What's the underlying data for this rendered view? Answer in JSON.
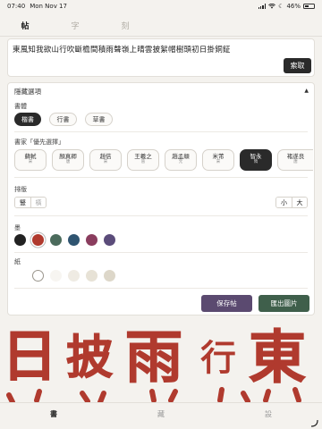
{
  "status": {
    "time": "07:40",
    "date": "Mon Nov 17",
    "battery": "46%",
    "battery_level": 0.46
  },
  "tabs": [
    {
      "label": "帖",
      "active": true
    },
    {
      "label": "字",
      "active": false
    },
    {
      "label": "刻",
      "active": false
    }
  ],
  "input": {
    "text": "東風知我欲山行吹斷檐間積雨聲嶺上晴雲披絮帽樹頭初日掛銅鉦"
  },
  "search_button": "索取",
  "options": {
    "header": "隱藏選項",
    "toggle_icon": "triangle-up-icon",
    "style_label": "書體",
    "styles": [
      "楷書",
      "行書",
      "草書"
    ],
    "style_selected": "楷書",
    "calligrapher_label": "書家「優先選擇」",
    "calligraphers": [
      {
        "name": "蘇軾",
        "era": "宋"
      },
      {
        "name": "顏真卿",
        "era": "唐"
      },
      {
        "name": "趙佶",
        "era": "宋"
      },
      {
        "name": "王羲之",
        "era": "晉"
      },
      {
        "name": "趙孟頫",
        "era": "元"
      },
      {
        "name": "米芾",
        "era": "宋"
      },
      {
        "name": "智永",
        "era": "隋",
        "selected": true
      },
      {
        "name": "褚遂良",
        "era": "唐"
      }
    ],
    "layout_label": "排版",
    "orientation": [
      "豎",
      "橫"
    ],
    "orientation_selected": "豎",
    "size": [
      "小",
      "大"
    ],
    "ink_label": "墨",
    "ink_colors": [
      "#222222",
      "#b03a2e",
      "#4b6b5c",
      "#2f5470",
      "#8a3d5e",
      "#5b4c7a"
    ],
    "ink_selected": 1,
    "paper_label": "紙",
    "paper_colors": [
      "#ffffff",
      "#f7f5f1",
      "#efebe3",
      "#e7e2d6",
      "#ddd7c9"
    ],
    "paper_selected": 0,
    "save_button": "保存帖",
    "export_button": "匯出圖片",
    "save_color": "#5b4a70",
    "export_color": "#3f5f4b"
  },
  "preview": {
    "ink": "#b03a2e",
    "chars": [
      "日",
      "披",
      "雨",
      "行",
      "東"
    ]
  },
  "bottom_tabs": [
    {
      "label": "書",
      "active": true
    },
    {
      "label": "藏",
      "active": false
    },
    {
      "label": "設",
      "active": false
    }
  ]
}
